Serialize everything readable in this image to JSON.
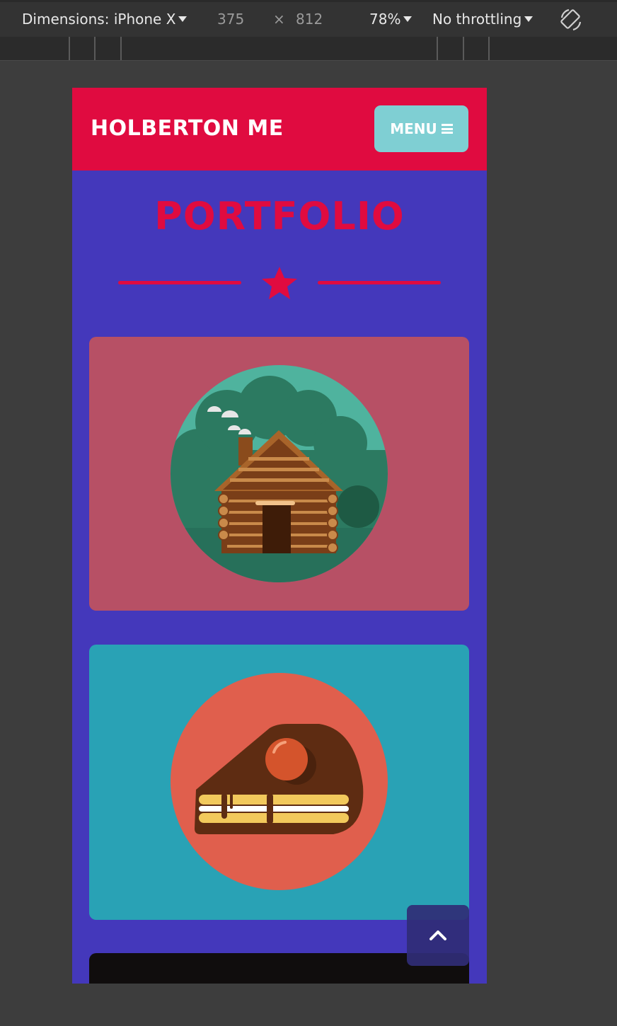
{
  "devtools": {
    "device_label": "Dimensions: iPhone X",
    "width": "375",
    "times": "×",
    "height": "812",
    "zoom": "78%",
    "throttling": "No throttling"
  },
  "site": {
    "brand": "HOLBERTON ME",
    "menu_label": "MENU",
    "page_title": "PORTFOLIO",
    "colors": {
      "header": "#e00b40",
      "background": "#4438bb",
      "menu_button": "#7fcfd3",
      "card_1": "#b75065",
      "card_2": "#29a2b5",
      "card_3": "#100d0d"
    },
    "cards": [
      {
        "image": "log-cabin-illustration"
      },
      {
        "image": "cake-slice-illustration"
      },
      {
        "image": "dark-card"
      }
    ],
    "back_to_top_icon": "chevron-up-icon"
  }
}
